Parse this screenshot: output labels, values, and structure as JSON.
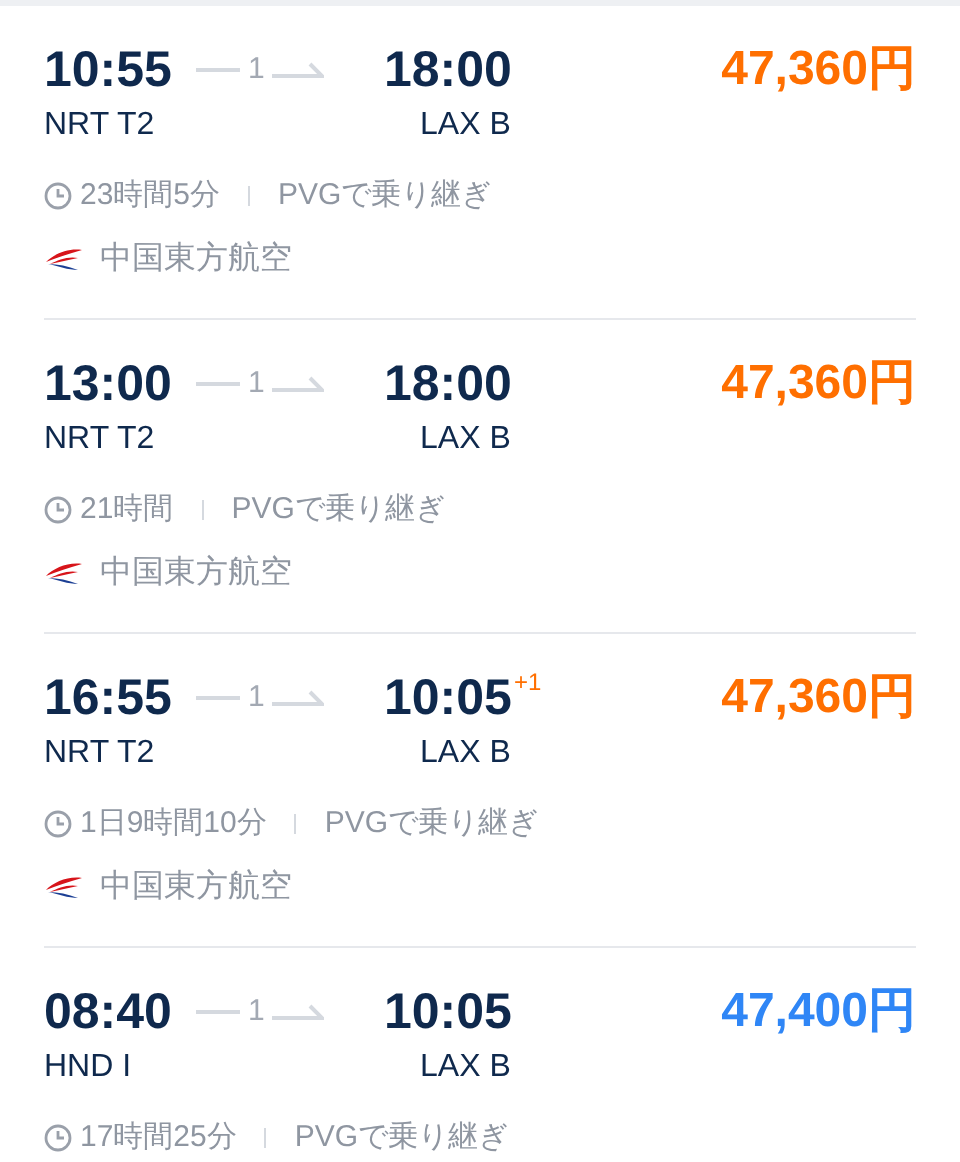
{
  "flights": [
    {
      "depart_time": "10:55",
      "arrive_time": "18:00",
      "stops": "1",
      "depart_airport": "NRT T2",
      "arrive_airport": "LAX B",
      "price": "47,360円",
      "color": "#ff6f00",
      "duration": "23時間5分",
      "transfer": "PVGで乗り継ぎ",
      "airline": "中国東方航空"
    },
    {
      "depart_time": "13:00",
      "arrive_time": "18:00",
      "stops": "1",
      "depart_airport": "NRT T2",
      "arrive_airport": "LAX B",
      "price": "47,360円",
      "color": "#ff6f00",
      "duration": "21時間",
      "transfer": "PVGで乗り継ぎ",
      "airline": "中国東方航空"
    },
    {
      "depart_time": "16:55",
      "arrive_time": "10:05",
      "day_offset": "+1",
      "stops": "1",
      "depart_airport": "NRT T2",
      "arrive_airport": "LAX B",
      "price": "47,360円",
      "color": "#ff6f00",
      "duration": "1日9時間10分",
      "transfer": "PVGで乗り継ぎ",
      "airline": "中国東方航空"
    },
    {
      "depart_time": "08:40",
      "arrive_time": "10:05",
      "stops": "1",
      "depart_airport": "HND I",
      "arrive_airport": "LAX B",
      "price": "47,400円",
      "color": "#2f86f6",
      "duration": "17時間25分",
      "transfer": "PVGで乗り継ぎ"
    }
  ]
}
